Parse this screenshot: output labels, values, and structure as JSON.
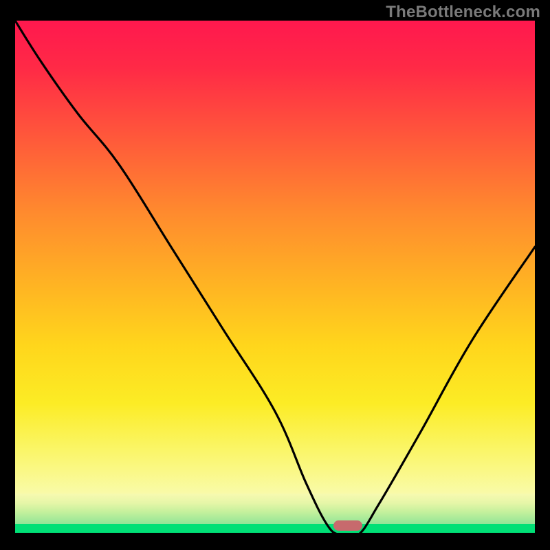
{
  "watermark": "TheBottleneck.com",
  "colors": {
    "background": "#000000",
    "gradient_top": "#ff184e",
    "gradient_mid1": "#ff8a2e",
    "gradient_mid2": "#ffd61c",
    "gradient_low": "#f9fbb0",
    "green_strip": "#00e076",
    "curve": "#000000",
    "marker": "#c76a6d",
    "watermark_text": "#7a7a7a"
  },
  "chart_data": {
    "type": "line",
    "title": "",
    "xlabel": "",
    "ylabel": "",
    "xlim": [
      0,
      100
    ],
    "ylim": [
      0,
      100
    ],
    "note": "Bottleneck-style V curve over heat gradient. No axes, ticks, or labels shown.",
    "series": [
      {
        "name": "bottleneck-curve",
        "x": [
          0,
          5,
          12,
          20,
          30,
          40,
          50,
          56,
          60,
          62.5,
          66,
          70,
          78,
          88,
          100
        ],
        "y": [
          100,
          92,
          82,
          72,
          56,
          40,
          24,
          10,
          2,
          0,
          0,
          6,
          20,
          38,
          56
        ]
      }
    ],
    "marker": {
      "x": 64,
      "y": 0,
      "label": ""
    }
  }
}
